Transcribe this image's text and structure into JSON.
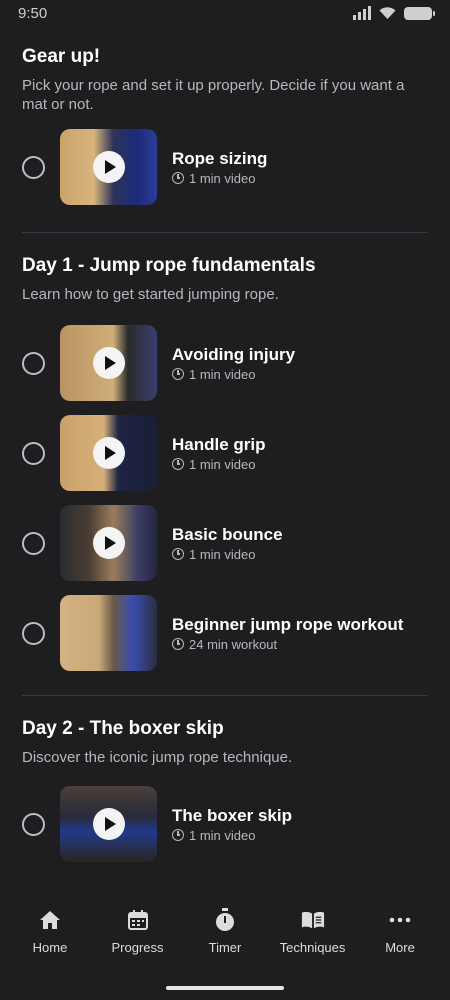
{
  "status_bar": {
    "time": "9:50"
  },
  "sections": [
    {
      "title": "Gear up!",
      "description": "Pick your rope and set it up properly. Decide if you want a mat or not.",
      "lessons": [
        {
          "title": "Rope sizing",
          "meta": "1 min video"
        }
      ]
    },
    {
      "title": "Day 1 - Jump rope fundamentals",
      "description": "Learn how to get started jumping rope.",
      "lessons": [
        {
          "title": "Avoiding injury",
          "meta": "1 min video"
        },
        {
          "title": "Handle grip",
          "meta": "1 min video"
        },
        {
          "title": "Basic bounce",
          "meta": "1 min video"
        },
        {
          "title": "Beginner jump rope workout",
          "meta": "24 min workout"
        }
      ]
    },
    {
      "title": "Day 2 - The boxer skip",
      "description": "Discover the iconic jump rope technique.",
      "lessons": [
        {
          "title": "The boxer skip",
          "meta": "1 min video"
        }
      ]
    }
  ],
  "nav": {
    "items": [
      {
        "label": "Home",
        "icon": "home-icon"
      },
      {
        "label": "Progress",
        "icon": "calendar-icon"
      },
      {
        "label": "Timer",
        "icon": "stopwatch-icon"
      },
      {
        "label": "Techniques",
        "icon": "book-icon"
      },
      {
        "label": "More",
        "icon": "more-icon"
      }
    ]
  }
}
